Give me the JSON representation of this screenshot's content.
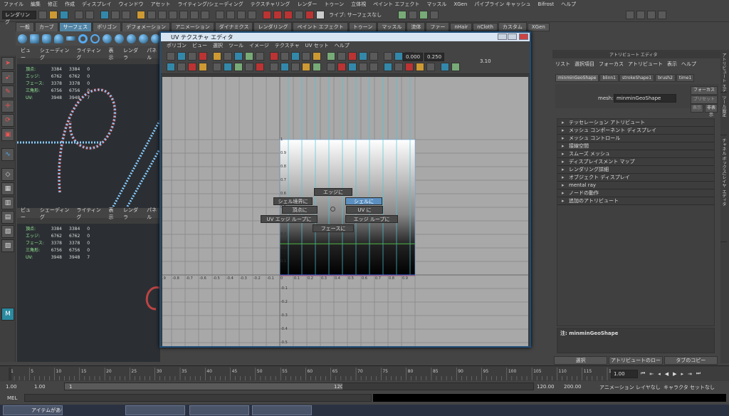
{
  "menubar": [
    "ファイル",
    "編集",
    "修正",
    "作成",
    "ディスプレイ",
    "ウィンドウ",
    "アセット",
    "ライティング/シェーディング",
    "テクスチャリング",
    "レンダー",
    "トゥーン",
    "立体視",
    "ペイント エフェクト",
    "マッスル",
    "XGen",
    "パイプライン キャッシュ",
    "Bifrost",
    "ヘルプ"
  ],
  "status": {
    "mode": "レンダリング",
    "live_label": "ライブ: サーフェスなし"
  },
  "shelf_tabs": [
    "一般",
    "カーブ",
    "サーフェス",
    "ポリゴン",
    "デフォメーション",
    "アニメーション",
    "ダイナミクス",
    "レンダリング",
    "ペイント エフェクト",
    "トゥーン",
    "マッスル",
    "流体",
    "ファー",
    "nHair",
    "nCloth",
    "カスタム",
    "XGen"
  ],
  "shelf_active": "サーフェス",
  "viewport": {
    "menu": [
      "ビュー",
      "シェーディング",
      "ライティング",
      "表示",
      "レンダラ",
      "パネル"
    ],
    "hud_rows": [
      [
        "頂点:",
        "3384",
        "3384",
        "0"
      ],
      [
        "エッジ:",
        "6762",
        "6762",
        "0"
      ],
      [
        "フェース:",
        "3378",
        "3378",
        "0"
      ],
      [
        "三角形:",
        "6756",
        "6756",
        "0"
      ],
      [
        "UV:",
        "3948",
        "3948",
        "7"
      ]
    ]
  },
  "uv_editor": {
    "title": "UV テクスチャ エディタ",
    "menu": [
      "ポリゴン",
      "ビュー",
      "選択",
      "ツール",
      "イメージ",
      "テクスチャ",
      "UV セット",
      "ヘルプ"
    ],
    "field1": "0.000",
    "field2": "0.250",
    "field3": "3.10",
    "marking_menu": {
      "edge": "エッジに",
      "shell_border": "シェル境界に",
      "shell": "シェルに",
      "vertex": "頂点に",
      "uv": "UV に",
      "uv_edge_loop": "UV エッジ ループに",
      "edge_loop": "エッジ ループに",
      "face": "フェースに"
    },
    "axis_x": [
      "-0.9",
      "-0.8",
      "-0.7",
      "-0.6",
      "-0.5",
      "-0.4",
      "-0.3",
      "-0.2",
      "-0.1",
      "0",
      "0.1",
      "0.2",
      "0.3",
      "0.4",
      "0.5",
      "0.6",
      "0.7",
      "0.8",
      "0.9"
    ],
    "axis_y_pos": [
      "1",
      "0.9",
      "0.8",
      "0.7",
      "0.6",
      "0.5",
      "0.4",
      "0.3",
      "0.2",
      "0.1"
    ],
    "axis_y_neg": [
      "-0.1",
      "-0.2",
      "-0.3",
      "-0.4",
      "-0.5",
      "-0.6"
    ]
  },
  "attribute_editor": {
    "title": "アトリビュート エディタ",
    "menu": [
      "リスト",
      "選択項目",
      "フォーカス",
      "アトリビュート",
      "表示",
      "ヘルプ"
    ],
    "tabs": [
      "minminGeoShape",
      "blinn1",
      "strokeShape1",
      "brush2",
      "time1"
    ],
    "mesh_label": "mesh:",
    "mesh_value": "minminGeoShape",
    "focus_btn": "フォーカス",
    "preset_btn": "プリセット",
    "show_btn": "表示",
    "hide_btn": "非表示",
    "sections": [
      "テッセレーション アトリビュート",
      "メッシュ コンポーネント ディスプレイ",
      "メッシュ コントロール",
      "接線空間",
      "スムーズ メッシュ",
      "ディスプレイスメント マップ",
      "レンダリング詳細",
      "オブジェクト ディスプレイ",
      "mental ray",
      "ノードの動作",
      "追加のアトリビュート"
    ],
    "note": "注: minminGeoShape",
    "buttons": [
      "選択",
      "アトリビュートのロード",
      "タブのコピー"
    ]
  },
  "side_tabs": [
    "アトリビュート エディタ",
    "ツール設定",
    "チャネル ボックス/レイヤ エディタ"
  ],
  "timeline": {
    "ticks": [
      "1",
      "5",
      "10",
      "15",
      "20",
      "25",
      "30",
      "35",
      "40",
      "45",
      "50",
      "55",
      "60",
      "65",
      "70",
      "75",
      "80",
      "85",
      "90",
      "95",
      "100",
      "105",
      "110",
      "115",
      "120"
    ],
    "current": "1.00"
  },
  "range": {
    "start": "1.00",
    "start2": "1.00",
    "slider_start": "1",
    "slider_end": "120",
    "end": "120.00",
    "end2": "200.00",
    "anim_layer": "アニメーション レイヤなし",
    "char_set": "キャラクタ セットなし"
  },
  "cmdline": {
    "label": "MEL"
  },
  "taskbar": [
    "アイテムがありません",
    "",
    "",
    ""
  ]
}
